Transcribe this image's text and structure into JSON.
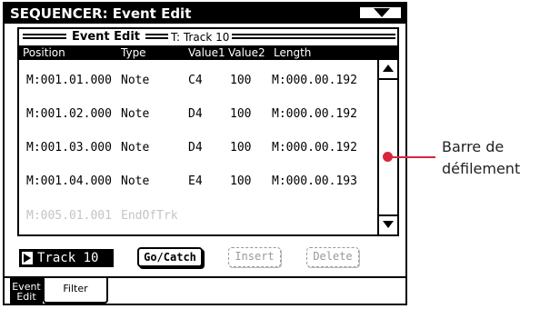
{
  "window": {
    "title": "SEQUENCER: Event Edit"
  },
  "panel": {
    "title": "Event Edit",
    "track_label": "T: Track 10"
  },
  "columns": [
    "Position",
    "Type",
    "Value1",
    "Value2",
    "Length"
  ],
  "events": [
    {
      "position": "M:001.01.000",
      "type": "Note",
      "value1": "C4",
      "value2": "100",
      "length": "M:000.00.192"
    },
    {
      "position": "M:001.02.000",
      "type": "Note",
      "value1": "D4",
      "value2": "100",
      "length": "M:000.00.192"
    },
    {
      "position": "M:001.03.000",
      "type": "Note",
      "value1": "D4",
      "value2": "100",
      "length": "M:000.00.192"
    },
    {
      "position": "M:001.04.000",
      "type": "Note",
      "value1": "E4",
      "value2": "100",
      "length": "M:000.00.193"
    },
    {
      "position": "M:005.01.001",
      "type": "EndOfTrk",
      "value1": "",
      "value2": "",
      "length": ""
    }
  ],
  "controls": {
    "track_selector": "Track 10",
    "gocatch": "Go/Catch",
    "insert": "Insert",
    "delete": "Delete"
  },
  "tabs": [
    {
      "label_line1": "Event",
      "label_line2": "Edit",
      "active": true
    },
    {
      "label": "Filter",
      "active": false
    }
  ],
  "annotation": {
    "line1": "Barre de",
    "line2": "défilement"
  },
  "colors": {
    "accent": "#d7263d",
    "disabled_text": "#c4c4c4"
  }
}
